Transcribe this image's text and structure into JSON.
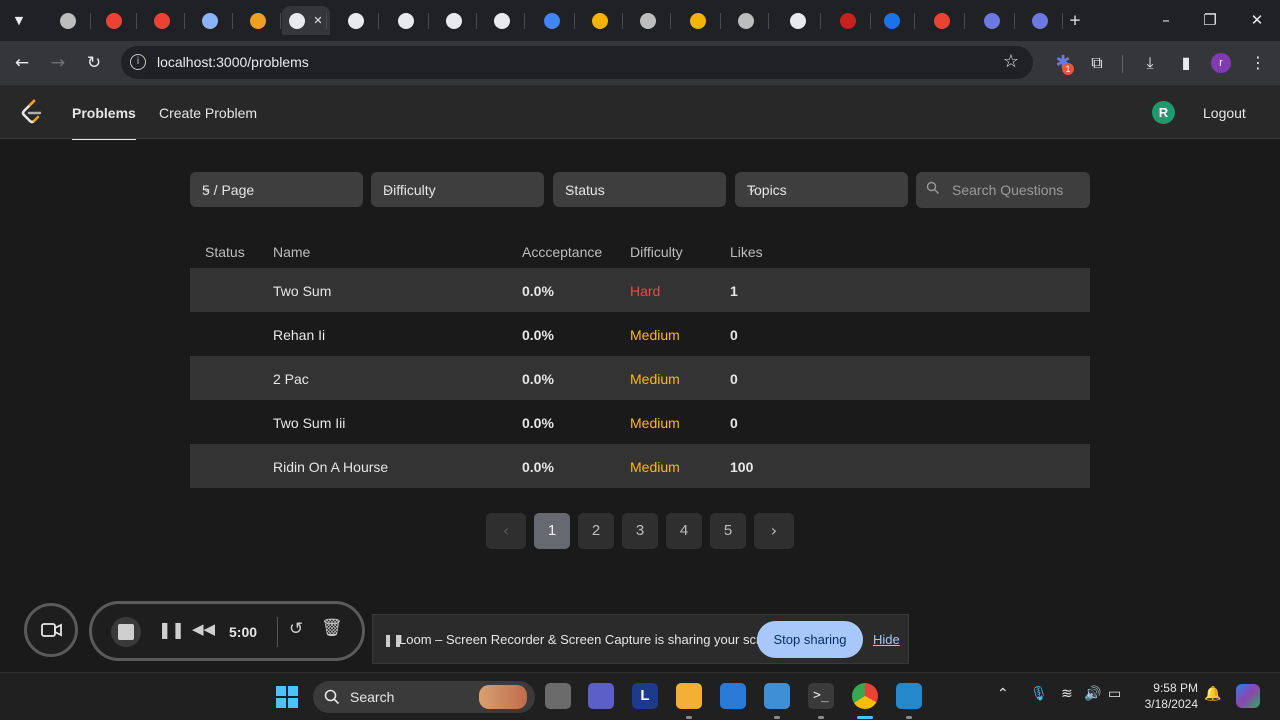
{
  "browser": {
    "url": "localhost:3000/problems",
    "tab_icon_colors": [
      "#bdbdbd",
      "#ea4335",
      "#ea4335",
      "#8ab4f8",
      "#f0a020",
      "#e8eaed",
      "#e8eaed",
      "#e8eaed",
      "#e8eaed",
      "#e8eaed",
      "#4285f4",
      "#f4b400",
      "#bdbdbd",
      "#f4b400",
      "#bdbdbd",
      "#e8eaed",
      "#c5221f",
      "#1a73e8",
      "#ea4335",
      "#6c7ae0",
      "#6c7ae0"
    ],
    "profile_initial": "r",
    "extension_badge": "1"
  },
  "app": {
    "nav": {
      "problems": "Problems",
      "create_problem": "Create Problem",
      "avatar_initial": "R",
      "logout": "Logout"
    },
    "filters": {
      "page_size": "5 / Page",
      "difficulty": "Difficulty",
      "status": "Status",
      "topics": "Topics",
      "search_placeholder": "Search Questions"
    },
    "table": {
      "headers": {
        "status": "Status",
        "name": "Name",
        "acceptance": "Accceptance",
        "difficulty": "Difficulty",
        "likes": "Likes"
      },
      "rows": [
        {
          "name": "Two Sum",
          "acceptance": "0.0%",
          "difficulty": "Hard",
          "likes": "1"
        },
        {
          "name": "Rehan Ii",
          "acceptance": "0.0%",
          "difficulty": "Medium",
          "likes": "0"
        },
        {
          "name": "2 Pac",
          "acceptance": "0.0%",
          "difficulty": "Medium",
          "likes": "0"
        },
        {
          "name": "Two Sum Iii",
          "acceptance": "0.0%",
          "difficulty": "Medium",
          "likes": "0"
        },
        {
          "name": "Ridin On A Hourse",
          "acceptance": "0.0%",
          "difficulty": "Medium",
          "likes": "100"
        }
      ]
    },
    "pagination": {
      "pages": [
        "1",
        "2",
        "3",
        "4",
        "5"
      ],
      "current": "1"
    },
    "colors": {
      "hard": "#ef4743",
      "medium": "#ffb800",
      "accent": "#a8c7fa"
    }
  },
  "loom": {
    "timer": "5:00",
    "share_message": "Loom – Screen Recorder & Screen Capture is sharing your screen.",
    "stop_sharing": "Stop sharing",
    "hide": "Hide"
  },
  "taskbar": {
    "search_label": "Search",
    "time": "9:58 PM",
    "date": "3/18/2024"
  }
}
